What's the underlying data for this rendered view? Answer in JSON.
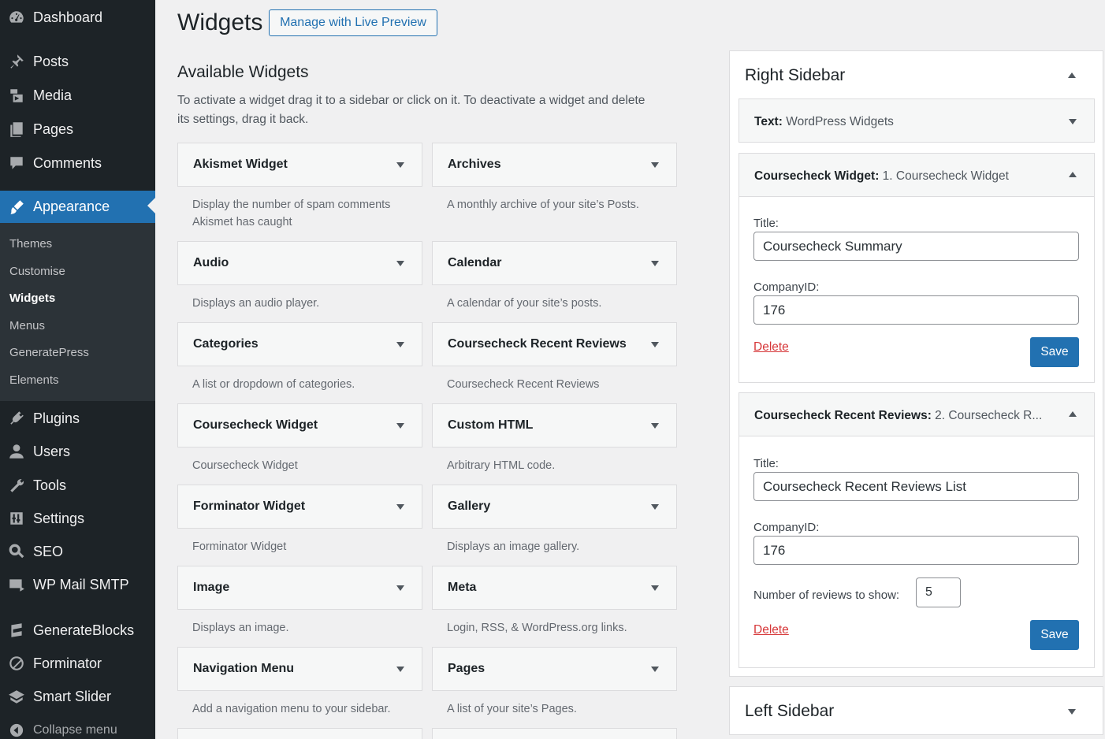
{
  "sidebar": {
    "items": [
      {
        "label": "Dashboard",
        "icon": "dashboard-icon"
      },
      {
        "label": "Posts",
        "icon": "pin-icon"
      },
      {
        "label": "Media",
        "icon": "media-icon"
      },
      {
        "label": "Pages",
        "icon": "pages-icon"
      },
      {
        "label": "Comments",
        "icon": "comment-icon"
      },
      {
        "label": "Appearance",
        "icon": "brush-icon"
      },
      {
        "label": "Plugins",
        "icon": "plugin-icon"
      },
      {
        "label": "Users",
        "icon": "user-icon"
      },
      {
        "label": "Tools",
        "icon": "wrench-icon"
      },
      {
        "label": "Settings",
        "icon": "settings-icon"
      },
      {
        "label": "SEO",
        "icon": "search-icon"
      },
      {
        "label": "WP Mail SMTP",
        "icon": "mail-icon"
      },
      {
        "label": "GenerateBlocks",
        "icon": "blocks-icon"
      },
      {
        "label": "Forminator",
        "icon": "forminator-icon"
      },
      {
        "label": "Smart Slider",
        "icon": "slider-icon"
      }
    ],
    "submenu": [
      "Themes",
      "Customise",
      "Widgets",
      "Menus",
      "GeneratePress",
      "Elements"
    ],
    "collapse_label": "Collapse menu"
  },
  "header": {
    "title": "Widgets",
    "live_preview": "Manage with Live Preview"
  },
  "available": {
    "title": "Available Widgets",
    "description": "To activate a widget drag it to a sidebar or click on it. To deactivate a widget and delete its settings, drag it back.",
    "widgets": [
      {
        "name": "Akismet Widget",
        "desc": "Display the number of spam comments Akismet has caught"
      },
      {
        "name": "Archives",
        "desc": "A monthly archive of your site’s Posts."
      },
      {
        "name": "Audio",
        "desc": "Displays an audio player."
      },
      {
        "name": "Calendar",
        "desc": "A calendar of your site’s posts."
      },
      {
        "name": "Categories",
        "desc": "A list or dropdown of categories."
      },
      {
        "name": "Coursecheck Recent Reviews",
        "desc": "Coursecheck Recent Reviews"
      },
      {
        "name": "Coursecheck Widget",
        "desc": "Coursecheck Widget"
      },
      {
        "name": "Custom HTML",
        "desc": "Arbitrary HTML code."
      },
      {
        "name": "Forminator Widget",
        "desc": "Forminator Widget"
      },
      {
        "name": "Gallery",
        "desc": "Displays an image gallery."
      },
      {
        "name": "Image",
        "desc": "Displays an image."
      },
      {
        "name": "Meta",
        "desc": "Login, RSS, & WordPress.org links."
      },
      {
        "name": "Navigation Menu",
        "desc": "Add a navigation menu to your sidebar."
      },
      {
        "name": "Pages",
        "desc": "A list of your site’s Pages."
      }
    ]
  },
  "right_sidebar": {
    "title": "Right Sidebar",
    "text_widget": {
      "type": "Text",
      "title": "WordPress Widgets"
    },
    "coursecheck_widget": {
      "type": "Coursecheck Widget",
      "subtitle": "1. Coursecheck Widget",
      "title_label": "Title:",
      "title_value": "Coursecheck Summary",
      "company_label": "CompanyID:",
      "company_value": "176",
      "delete": "Delete",
      "save": "Save"
    },
    "reviews_widget": {
      "type": "Coursecheck Recent Reviews",
      "subtitle": "2. Coursecheck R...",
      "title_label": "Title:",
      "title_value": "Coursecheck Recent Reviews List",
      "company_label": "CompanyID:",
      "company_value": "176",
      "count_label": "Number of reviews to show:",
      "count_value": "5",
      "delete": "Delete",
      "save": "Save"
    }
  },
  "left_sidebar": {
    "title": "Left Sidebar"
  },
  "colors": {
    "accent": "#2271b1",
    "menu_bg": "#1d2327",
    "submenu_bg": "#2c3338",
    "delete": "#d63638"
  }
}
